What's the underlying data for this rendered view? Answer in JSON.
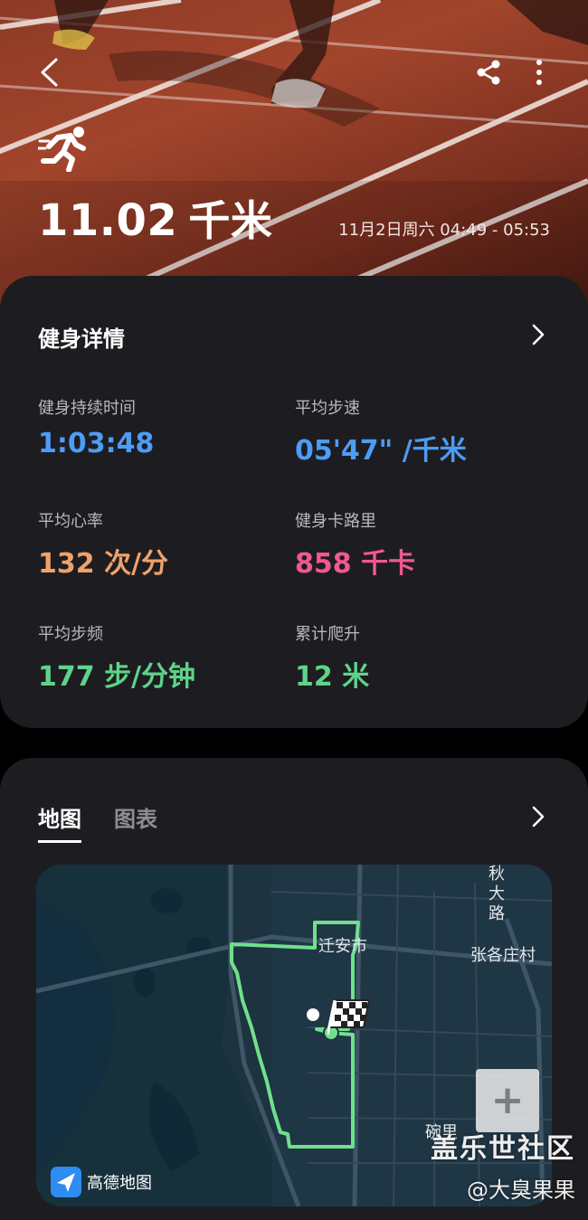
{
  "header": {
    "back_icon": "chevron-left-icon",
    "share_icon": "share-icon",
    "more_icon": "more-vertical-icon",
    "activity_icon": "running-icon",
    "distance_value": "11.02",
    "distance_unit": "千米",
    "datetime": "11月2日周六 04:49 - 05:53"
  },
  "details": {
    "title": "健身详情",
    "metrics": [
      {
        "label": "健身持续时间",
        "value": "1:03:48",
        "color": "#4d9cf5"
      },
      {
        "label": "平均步速",
        "value": "05'47\" /千米",
        "color": "#4d9cf5"
      },
      {
        "label": "平均心率",
        "value": "132 次/分",
        "color": "#f0a16b"
      },
      {
        "label": "健身卡路里",
        "value": "858 千卡",
        "color": "#f2588f"
      },
      {
        "label": "平均步频",
        "value": "177 步/分钟",
        "color": "#5fd389"
      },
      {
        "label": "累计爬升",
        "value": "12 米",
        "color": "#5fd389"
      }
    ]
  },
  "map_section": {
    "tabs": [
      {
        "label": "地图",
        "active": true
      },
      {
        "label": "图表",
        "active": false
      }
    ],
    "map_labels": {
      "city": "迁安市",
      "village": "张各庄村",
      "road": "秋大路",
      "place": "碗里"
    },
    "zoom_in_label": "+",
    "provider": "高德地图",
    "route_color": "#6fe08c"
  },
  "watermark": {
    "line1": "盖乐世社区",
    "line2": "@大臭果果"
  }
}
